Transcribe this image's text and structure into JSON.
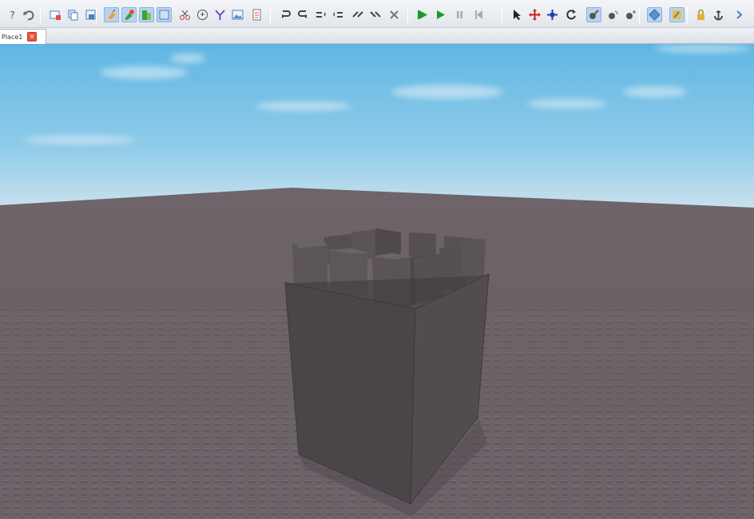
{
  "toolbar": {
    "buttons": [
      {
        "name": "help-icon",
        "active": false
      },
      {
        "name": "undo-icon",
        "active": false
      },
      {
        "name": "insert-model-icon",
        "active": false
      },
      {
        "name": "copy-icon",
        "active": false
      },
      {
        "name": "paste-icon",
        "active": false
      },
      {
        "name": "fill-tool-icon",
        "active": true
      },
      {
        "name": "paint-tool-icon",
        "active": true
      },
      {
        "name": "material-tool-icon",
        "active": true
      },
      {
        "name": "surface-tool-icon",
        "active": true
      },
      {
        "name": "cut-icon",
        "active": false
      },
      {
        "name": "dropper-icon",
        "active": false
      },
      {
        "name": "group-icon",
        "active": false
      },
      {
        "name": "image-icon",
        "active": false
      },
      {
        "name": "script-icon",
        "active": false
      },
      {
        "name": "rotate-left-icon",
        "active": false
      },
      {
        "name": "rotate-right-icon",
        "active": false
      },
      {
        "name": "tilt-left-icon",
        "active": false
      },
      {
        "name": "tilt-right-icon",
        "active": false
      },
      {
        "name": "move-up-icon",
        "active": false
      },
      {
        "name": "move-down-icon",
        "active": false
      },
      {
        "name": "delete-icon",
        "active": false
      },
      {
        "name": "play-icon",
        "active": false
      },
      {
        "name": "run-icon",
        "active": false
      },
      {
        "name": "pause-icon",
        "active": false
      },
      {
        "name": "reset-icon",
        "active": false
      },
      {
        "name": "select-arrow-icon",
        "active": false
      },
      {
        "name": "move-icon",
        "active": false
      },
      {
        "name": "resize-icon",
        "active": false
      },
      {
        "name": "rotate-icon",
        "active": false
      },
      {
        "name": "camera-pan-icon",
        "active": true
      },
      {
        "name": "camera-orbit-icon",
        "active": false
      },
      {
        "name": "camera-zoom-icon",
        "active": false
      },
      {
        "name": "snap-icon",
        "active": true
      },
      {
        "name": "anchor-material-icon",
        "active": true
      },
      {
        "name": "lock-icon",
        "active": false
      },
      {
        "name": "anchor-icon",
        "active": false
      },
      {
        "name": "more-icon",
        "active": false
      }
    ]
  },
  "tabs": {
    "document_label": "Place1",
    "close_glyph": "×"
  },
  "colors": {
    "sky_top": "#5fb6e2",
    "sky_bottom": "#cfe4ee",
    "baseplate": "#6b6268",
    "tower_front": "#4a4548",
    "tower_side": "#514b4f",
    "accent_active": "#b9d3ef",
    "close_button": "#e8553f"
  }
}
